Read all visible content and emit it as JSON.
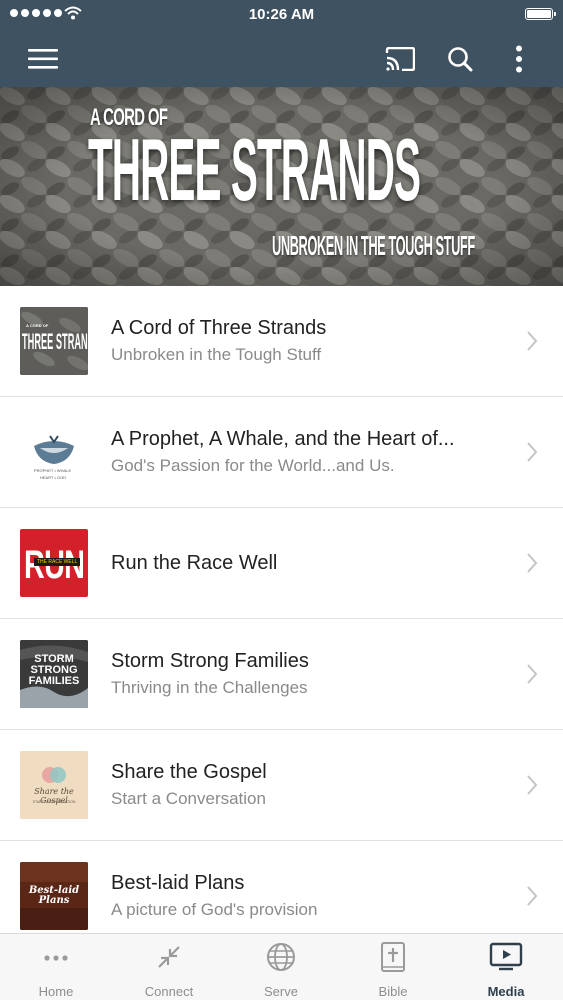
{
  "status_bar": {
    "time": "10:26 AM"
  },
  "nav": {
    "menu_icon": "hamburger-icon",
    "cast_icon": "cast-icon",
    "search_icon": "search-icon",
    "more_icon": "more-vertical-icon"
  },
  "hero": {
    "line1": "A CORD OF",
    "line2": "THREE STRANDS",
    "line3": "UNBROKEN IN THE TOUGH STUFF"
  },
  "series": [
    {
      "title": "A Cord of Three Strands",
      "subtitle": "Unbroken in the Tough Stuff",
      "thumb_text": "THREE STRANDS",
      "thumb_small": "A CORD OF"
    },
    {
      "title": "A Prophet, A Whale, and the Heart of...",
      "subtitle": "God's Passion for the World...and Us.",
      "thumb_text": "PROPHET • WHALE",
      "thumb_small": "HEART • GOD"
    },
    {
      "title": "Run the Race Well",
      "subtitle": "",
      "thumb_text": "RUN",
      "thumb_small": "THE RACE WELL"
    },
    {
      "title": "Storm Strong Families",
      "subtitle": "Thriving in the Challenges",
      "thumb_text": "STORM STRONG FAMILIES",
      "thumb_small": ""
    },
    {
      "title": "Share the Gospel",
      "subtitle": "Start a Conversation",
      "thumb_text": "Share the Gospel",
      "thumb_small": "START A CONVERSATION"
    },
    {
      "title": "Best-laid Plans",
      "subtitle": "A picture of God's provision",
      "thumb_text": "Best-laid Plans",
      "thumb_small": ""
    }
  ],
  "tabs": [
    {
      "label": "Home",
      "icon": "more-horizontal-icon"
    },
    {
      "label": "Connect",
      "icon": "connect-arrows-icon"
    },
    {
      "label": "Serve",
      "icon": "globe-icon"
    },
    {
      "label": "Bible",
      "icon": "bible-icon"
    },
    {
      "label": "Media",
      "icon": "media-play-icon",
      "active": true
    }
  ],
  "colors": {
    "header": "#3f5261",
    "active_tab": "#2f3f4c",
    "inactive_tab": "#8e8e8e"
  }
}
